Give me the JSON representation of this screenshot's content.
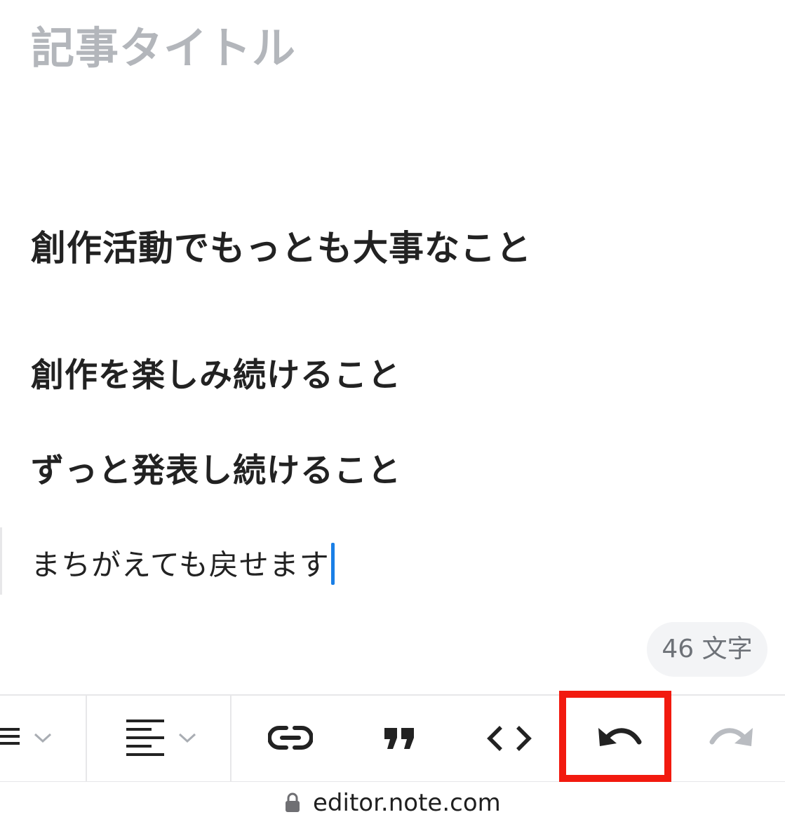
{
  "editor": {
    "title_placeholder": "記事タイトル",
    "headings": [
      "創作活動でもっとも大事なこと",
      "創作を楽しみ続けること",
      "ずっと発表し続けること"
    ],
    "body_text": "まちがえても戻せます",
    "char_count": "46 文字"
  },
  "toolbar": {
    "items": [
      {
        "icon": "list-icon",
        "has_dropdown": true
      },
      {
        "icon": "align-left-icon",
        "has_dropdown": true
      },
      {
        "icon": "link-icon"
      },
      {
        "icon": "quote-icon"
      },
      {
        "icon": "code-icon"
      },
      {
        "icon": "undo-icon",
        "highlighted": true
      },
      {
        "icon": "redo-icon",
        "disabled": true
      }
    ],
    "highlight_color": "#f21a0f"
  },
  "browser": {
    "url": "editor.note.com",
    "lock_icon": "lock-icon"
  },
  "colors": {
    "caret": "#1a7fe6",
    "placeholder": "#b3b6bb",
    "text": "#222222"
  }
}
